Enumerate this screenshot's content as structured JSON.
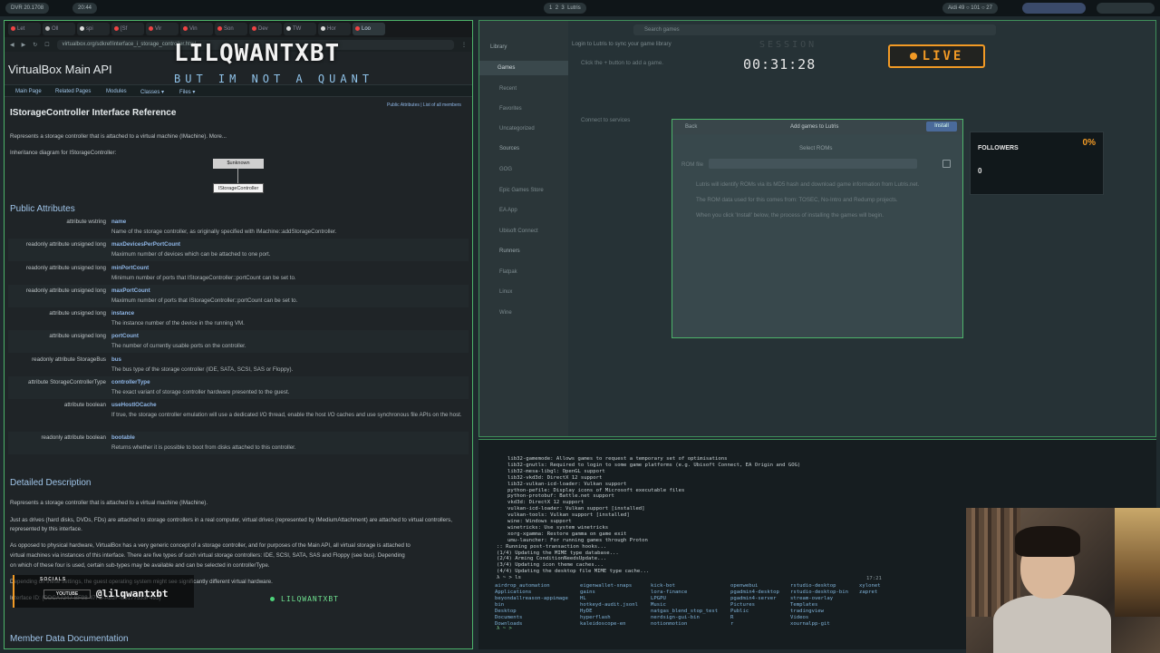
{
  "topbar": {
    "left_items": [
      "DVR",
      "20.1708",
      "20:44"
    ],
    "workspaces": [
      "1",
      "2",
      "3",
      "Lutris"
    ],
    "status_text": "Aidi 49 ○ 101 ○ 27"
  },
  "browser": {
    "tabs": [
      "Let",
      "Oll",
      "spi",
      "[Sf",
      "Vir",
      "Vin",
      "Son",
      "Dev",
      "TW",
      "Hor",
      "Loo"
    ],
    "url": "virtualbox.org/sdkref/interface_i_storage_controller.html",
    "page": {
      "site_title": "VirtualBox Main API",
      "nav": [
        "Main Page",
        "Related Pages",
        "Modules",
        "Classes ▾",
        "Files ▾"
      ],
      "nav_right": "Public Attributes | List of all members",
      "title": "IStorageController Interface Reference",
      "intro": "Represents a storage controller that is attached to a virtual machine (IMachine). More...",
      "inheritance_label": "Inheritance diagram for IStorageController:",
      "diagram_top": "$unknown",
      "diagram_bottom": "IStorageController",
      "public_attributes_heading": "Public Attributes",
      "attributes": [
        {
          "type": "attribute wstring",
          "name": "name",
          "desc": "Name of the storage controller, as originally specified with IMachine::addStorageController."
        },
        {
          "type": "readonly attribute unsigned long",
          "name": "maxDevicesPerPortCount",
          "desc": "Maximum number of devices which can be attached to one port."
        },
        {
          "type": "readonly attribute unsigned long",
          "name": "minPortCount",
          "desc": "Minimum number of ports that IStorageController::portCount can be set to."
        },
        {
          "type": "readonly attribute unsigned long",
          "name": "maxPortCount",
          "desc": "Maximum number of ports that IStorageController::portCount can be set to."
        },
        {
          "type": "attribute unsigned long",
          "name": "instance",
          "desc": "The instance number of the device in the running VM."
        },
        {
          "type": "attribute unsigned long",
          "name": "portCount",
          "desc": "The number of currently usable ports on the controller."
        },
        {
          "type": "readonly attribute StorageBus",
          "name": "bus",
          "desc": "The bus type of the storage controller (IDE, SATA, SCSI, SAS or Floppy)."
        },
        {
          "type": "attribute StorageControllerType",
          "name": "controllerType",
          "desc": "The exact variant of storage controller hardware presented to the guest."
        },
        {
          "type": "attribute boolean",
          "name": "useHostIOCache",
          "desc": "If true, the storage controller emulation will use a dedicated I/O thread, enable the host I/O caches and use synchronous file APIs on the host."
        },
        {
          "type": "readonly attribute boolean",
          "name": "bootable",
          "desc": "Returns whether it is possible to boot from disks attached to this controller."
        }
      ],
      "detailed_heading": "Detailed Description",
      "detailed_p1": "Represents a storage controller that is attached to a virtual machine (IMachine).",
      "detailed_p2": "Just as drives (hard disks, DVDs, FDs) are attached to storage controllers in a real computer, virtual drives (represented by IMediumAttachment) are attached to virtual controllers, represented by this interface.",
      "detailed_p3a": "As opposed to physical hardware, VirtualBox has a very generic concept of a storage controller, and for purposes of the Main API, all virtual storage is attached to",
      "detailed_p3b": "virtual machines via instances of this interface. There are five types of such virtual storage controllers: IDE, SCSI, SATA, SAS and Floppy (see bus). Depending",
      "detailed_p3c": "on which of these four is used, certain sub-types may be available and can be selected in controllerType.",
      "detailed_p4": "Depending on these settings, the guest operating system might see significantly different virtual hardware.",
      "interface_id": "Interface ID: {DDCA7247-BF98-47FB-AB2F-B5177533F493}",
      "member_heading": "Member Data Documentation"
    }
  },
  "overlay": {
    "brand": "LILQWANTXBT",
    "brand_sub": "BUT IM NOT A QUANT",
    "clock": "00:31:28",
    "session": "SESSION",
    "live": "LIVE",
    "followers_label": "FOLLOWERS",
    "followers_pct": "0%",
    "followers_count": "0",
    "socials_label": "SOCIALS",
    "socials_platform": "YOUTUBE",
    "socials_handle": "@lilqwantxbt",
    "ticker": "LILQWANTXBT"
  },
  "lutris": {
    "sidebar_header": "Library",
    "items": [
      "Games",
      "Recent",
      "Favorites",
      "Uncategorized"
    ],
    "sources_header": "Sources",
    "sources": [
      "GOG",
      "Epic Games Store",
      "EA App",
      "Ubisoft Connect"
    ],
    "runners_header": "Runners",
    "runners": [
      "Flatpak",
      "Linux",
      "Wine"
    ],
    "search_placeholder": "Search games",
    "login_text": "Login to Lutris to sync your game library",
    "empty_hint": "Click the + button to add a game.",
    "connect_hint": "Connect to services",
    "dialog": {
      "back": "Back",
      "title": "Add games to Lutris",
      "install": "Install",
      "select": "Select ROMs",
      "rom_label": "ROM file",
      "line1": "Lutris will identify ROMs via its MD5 hash and download game information from Lutris.net.",
      "line2": "The ROM data used for this comes from: TOSEC, No-Intro and Redump projects.",
      "line3": "When you click 'Install' below, the process of installing the games will begin."
    }
  },
  "terminal": {
    "lines": [
      "lib32-gamemode: Allows games to request a temporary set of optimisations",
      "lib32-gnutls: Required to login to some game platforms (e.g. Ubisoft Connect, EA Origin and GOG)",
      "lib32-mesa-libgl: OpenGL support",
      "lib32-vkd3d: DirectX 12 support",
      "lib32-vulkan-icd-loader: Vulkan support",
      "python-pefile: Display icons of Microsoft executable files",
      "python-protobuf: Battle.net support",
      "vkd3d: DirectX 12 support",
      "vulkan-icd-loader: Vulkan support [installed]",
      "vulkan-tools: Vulkan support [installed]",
      "wine: Windows support",
      "winetricks: Use system winetricks",
      "xorg-xgamma: Restore gamma on game exit",
      "umu-launcher: For running games through Proton",
      ":: Running post-transaction hooks...",
      "(1/4) Updating the MIME type database...",
      "(2/4) Arming ConditionNeedsUpdate...",
      "(3/4) Updating icon theme caches...",
      "(4/4) Updating the desktop file MIME type cache...",
      "λ ~ > ls"
    ],
    "time": "17:21",
    "ls_cols": [
      [
        "airdrop_automation",
        "Applications",
        "beyondallreason-appimage",
        "bin",
        "Desktop",
        "Documents",
        "Downloads"
      ],
      [
        "eigenwallet-snaps",
        "gains",
        "HL",
        "hotkeyd-audit.jsonl",
        "HyDE",
        "hyperflash",
        "kaleidoscope-en"
      ],
      [
        "kick-bot",
        "lora-finance",
        "LPGPU",
        "Music",
        "natgas_blend_stop_test",
        "nerdsign-gui-bin",
        "notionmotion"
      ],
      [
        "openwebui",
        "pgadmin4-desktop",
        "pgadmin4-server",
        "Pictures",
        "Public",
        "R",
        "r"
      ],
      [
        "rstudio-desktop",
        "rstudio-desktop-bin",
        "stream-overlay",
        "Templates",
        "tradingview",
        "Videos",
        "xournalpp-git"
      ],
      [
        "xylonet",
        "zapret"
      ]
    ],
    "prompt": "λ ~ > "
  },
  "colors": {
    "accent_green": "#4db36a",
    "live_orange": "#f29a25",
    "link_blue": "#8fb6e6"
  }
}
